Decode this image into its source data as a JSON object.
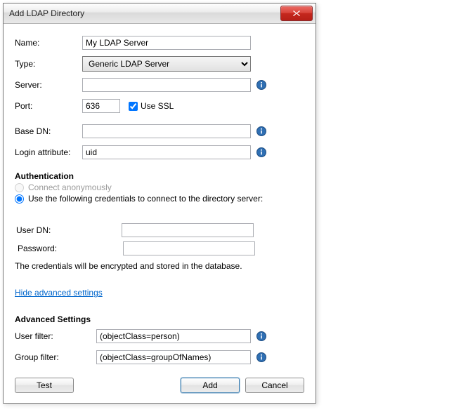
{
  "window": {
    "title": "Add LDAP Directory"
  },
  "labels": {
    "name": "Name:",
    "type": "Type:",
    "server": "Server:",
    "port": "Port:",
    "use_ssl": "Use SSL",
    "base_dn": "Base DN:",
    "login_attr": "Login attribute:",
    "auth_header": "Authentication",
    "auth_anon": "Connect anonymously",
    "auth_creds": "Use the following credentials to connect to the directory server:",
    "user_dn": "User DN:",
    "password": "Password:",
    "cred_note": "The credentials will be encrypted and stored in the database.",
    "hide_advanced": "Hide advanced settings",
    "adv_header": "Advanced Settings",
    "user_filter": "User filter:",
    "group_filter": "Group filter:"
  },
  "values": {
    "name": "My LDAP Server",
    "type": "Generic LDAP Server",
    "server": "",
    "port": "636",
    "use_ssl": true,
    "base_dn": "",
    "login_attr": "uid",
    "auth_mode": "creds",
    "user_dn": "",
    "password": "",
    "user_filter": "(objectClass=person)",
    "group_filter": "(objectClass=groupOfNames)"
  },
  "buttons": {
    "test": "Test",
    "add": "Add",
    "cancel": "Cancel"
  },
  "icons": {
    "info": "info-icon",
    "close": "close-icon"
  }
}
